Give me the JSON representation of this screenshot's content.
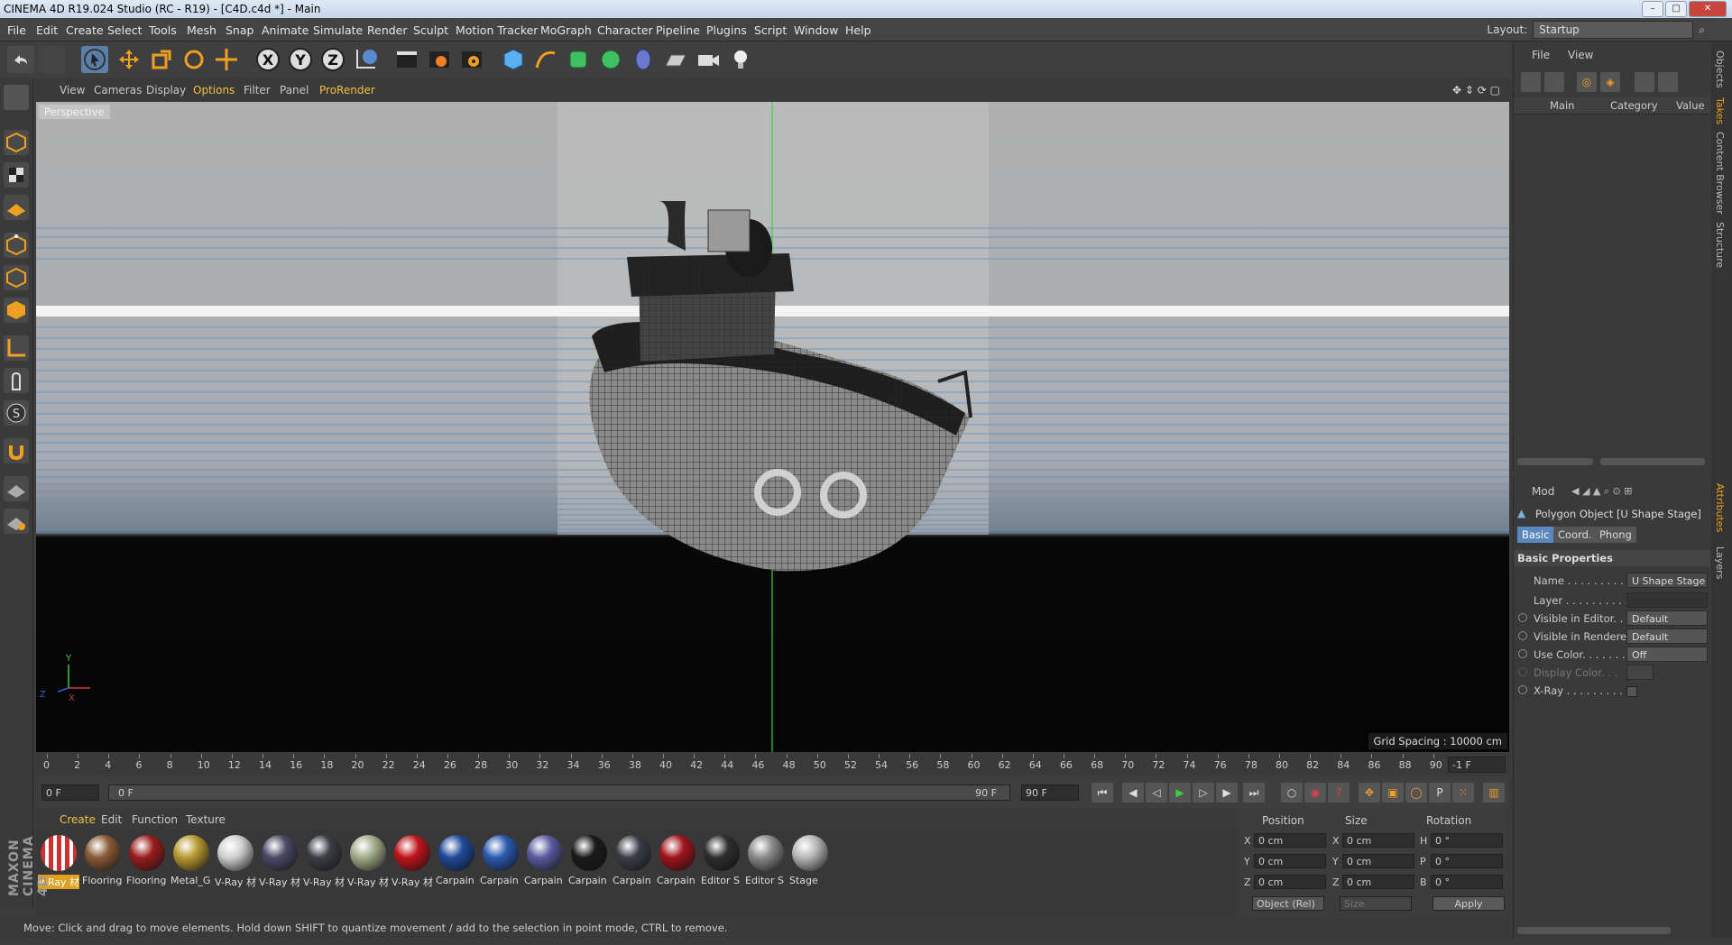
{
  "window": {
    "title": "CINEMA 4D R19.024 Studio (RC - R19) - [C4D.c4d *] - Main"
  },
  "menubar": {
    "items": [
      "File",
      "Edit",
      "Create",
      "Select",
      "Tools",
      "Mesh",
      "Snap",
      "Animate",
      "Simulate",
      "Render",
      "Sculpt",
      "Motion Tracker",
      "MoGraph",
      "Character",
      "Pipeline",
      "Plugins",
      "Script",
      "Window",
      "Help"
    ],
    "layout_label": "Layout:",
    "layout_value": "Startup"
  },
  "viewport": {
    "menu": [
      "View",
      "Cameras",
      "Display",
      "Options",
      "Filter",
      "Panel",
      "ProRender"
    ],
    "camera_label": "Perspective",
    "grid_spacing": "Grid Spacing : 10000 cm",
    "axis_labels": {
      "y": "Y",
      "x": "X",
      "z": "Z"
    }
  },
  "timeline": {
    "ticks": [
      "0",
      "2",
      "4",
      "6",
      "8",
      "10",
      "12",
      "14",
      "16",
      "18",
      "20",
      "22",
      "24",
      "26",
      "28",
      "30",
      "32",
      "34",
      "36",
      "38",
      "40",
      "42",
      "44",
      "46",
      "48",
      "50",
      "52",
      "54",
      "56",
      "58",
      "60",
      "62",
      "64",
      "66",
      "68",
      "70",
      "72",
      "74",
      "76",
      "78",
      "80",
      "82",
      "84",
      "86",
      "88",
      "90"
    ],
    "current_frame_field": "-1 F",
    "start_frame": "0 F",
    "slider_start": "0 F",
    "slider_end": "90 F",
    "end_frame": "90 F"
  },
  "materials": {
    "menu": [
      "Create",
      "Edit",
      "Function",
      "Texture"
    ],
    "items": [
      {
        "label": "V-Ray 材",
        "color": "#c83030",
        "selected": true
      },
      {
        "label": "Flooring",
        "color": "#8a5a36",
        "selected": false
      },
      {
        "label": "Flooring",
        "color": "#9a1c1c",
        "selected": false
      },
      {
        "label": "Metal_G",
        "color": "#b89a30",
        "selected": false
      },
      {
        "label": "V-Ray 材",
        "color": "#d0d0d0",
        "selected": false
      },
      {
        "label": "V-Ray 材",
        "color": "#4a4a66",
        "selected": false
      },
      {
        "label": "V-Ray 材",
        "color": "#3a3e46",
        "selected": false
      },
      {
        "label": "V-Ray 材",
        "color": "#a4ac8a",
        "selected": false
      },
      {
        "label": "V-Ray 材",
        "color": "#c0141c",
        "selected": false
      },
      {
        "label": "Carpain",
        "color": "#1e4a9a",
        "selected": false
      },
      {
        "label": "Carpain",
        "color": "#2a5ab0",
        "selected": false
      },
      {
        "label": "Carpain",
        "color": "#5a5aa0",
        "selected": false
      },
      {
        "label": "Carpain",
        "color": "#1a1a1a",
        "selected": false
      },
      {
        "label": "Carpain",
        "color": "#3a3e48",
        "selected": false
      },
      {
        "label": "Carpain",
        "color": "#a0141c",
        "selected": false
      },
      {
        "label": "Editor S",
        "color": "#2e2e2e",
        "selected": false
      },
      {
        "label": "Editor S",
        "color": "#8a8a8a",
        "selected": false
      },
      {
        "label": "Stage",
        "color": "#b8b8b8",
        "selected": false
      }
    ]
  },
  "coordinates": {
    "headers": [
      "Position",
      "Size",
      "Rotation"
    ],
    "rows": [
      {
        "axis": "X",
        "pos": "0 cm",
        "size_axis": "X",
        "size": "0 cm",
        "rot_axis": "H",
        "rot": "0 °"
      },
      {
        "axis": "Y",
        "pos": "0 cm",
        "size_axis": "Y",
        "size": "0 cm",
        "rot_axis": "P",
        "rot": "0 °"
      },
      {
        "axis": "Z",
        "pos": "0 cm",
        "size_axis": "Z",
        "size": "0 cm",
        "rot_axis": "B",
        "rot": "0 °"
      }
    ],
    "mode_select": "Object (Rel)",
    "size_select": "Size",
    "apply": "Apply"
  },
  "status": {
    "text": "Move: Click and drag to move elements. Hold down SHIFT to quantize movement / add to the selection in point mode, CTRL to remove."
  },
  "brand": "MAXON CINEMA 4D",
  "object_manager": {
    "menu": [
      "File",
      "View"
    ],
    "columns": [
      "Main",
      "Category",
      "Value"
    ]
  },
  "attributes": {
    "mode": "Mod",
    "object_title": "Polygon Object [U Shape Stage]",
    "tabs": [
      "Basic",
      "Coord.",
      "Phong"
    ],
    "section": "Basic Properties",
    "rows": [
      {
        "label": "Name . . . . . . . . . .",
        "value": "U Shape Stage"
      },
      {
        "label": "Layer . . . . . . . . . .",
        "value": ""
      },
      {
        "label": "Visible in Editor. . .",
        "value": "Default"
      },
      {
        "label": "Visible in Renderer",
        "value": "Default"
      },
      {
        "label": "Use Color. . . . . . . .",
        "value": "Off"
      },
      {
        "label": "Display Color. . .",
        "value": ""
      },
      {
        "label": "X-Ray . . . . . . . . . .",
        "value": ""
      }
    ]
  },
  "right_tabs": [
    "Objects",
    "Takes",
    "Content Browser",
    "Structure",
    "Attributes",
    "Layers"
  ]
}
